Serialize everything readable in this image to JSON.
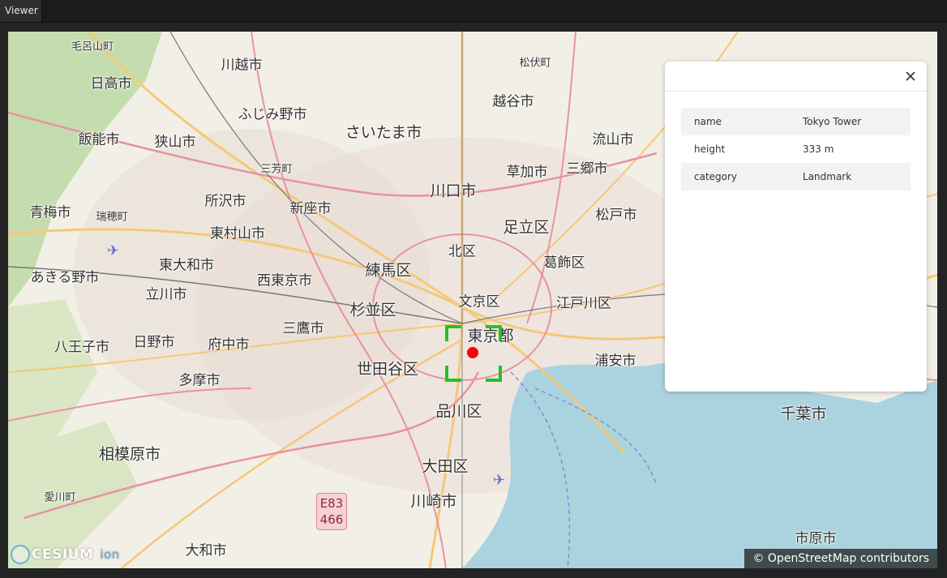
{
  "window": {
    "tab_label": "Viewer"
  },
  "map": {
    "labels": [
      {
        "text": "毛呂山町",
        "size": "small"
      },
      {
        "text": "日高市",
        "size": "med"
      },
      {
        "text": "川越市",
        "size": "med"
      },
      {
        "text": "ふじみ野市",
        "size": "med"
      },
      {
        "text": "越谷市",
        "size": "med"
      },
      {
        "text": "松伏町",
        "size": "small"
      },
      {
        "text": "飯能市",
        "size": "med"
      },
      {
        "text": "狭山市",
        "size": "med"
      },
      {
        "text": "さいたま市",
        "size": "big"
      },
      {
        "text": "流山市",
        "size": "med"
      },
      {
        "text": "三芳町",
        "size": "small"
      },
      {
        "text": "草加市",
        "size": "med"
      },
      {
        "text": "三郷市",
        "size": "med"
      },
      {
        "text": "川口市",
        "size": "big"
      },
      {
        "text": "青梅市",
        "size": "med"
      },
      {
        "text": "瑞穂町",
        "size": "small"
      },
      {
        "text": "所沢市",
        "size": "med"
      },
      {
        "text": "新座市",
        "size": "med"
      },
      {
        "text": "東村山市",
        "size": "med"
      },
      {
        "text": "松戸市",
        "size": "med"
      },
      {
        "text": "足立区",
        "size": "big"
      },
      {
        "text": "北区",
        "size": "med"
      },
      {
        "text": "東大和市",
        "size": "med"
      },
      {
        "text": "練馬区",
        "size": "big"
      },
      {
        "text": "葛飾区",
        "size": "med"
      },
      {
        "text": "あきる野市",
        "size": "med"
      },
      {
        "text": "西東京市",
        "size": "med"
      },
      {
        "text": "立川市",
        "size": "med"
      },
      {
        "text": "文京区",
        "size": "med"
      },
      {
        "text": "江戸川区",
        "size": "med"
      },
      {
        "text": "杉並区",
        "size": "big"
      },
      {
        "text": "三鷹市",
        "size": "med"
      },
      {
        "text": "東京都",
        "size": "big"
      },
      {
        "text": "八王子市",
        "size": "med"
      },
      {
        "text": "日野市",
        "size": "med"
      },
      {
        "text": "府中市",
        "size": "med"
      },
      {
        "text": "浦安市",
        "size": "med"
      },
      {
        "text": "世田谷区",
        "size": "big"
      },
      {
        "text": "多摩市",
        "size": "med"
      },
      {
        "text": "品川区",
        "size": "big"
      },
      {
        "text": "千葉市",
        "size": "big"
      },
      {
        "text": "相模原市",
        "size": "big"
      },
      {
        "text": "大田区",
        "size": "big"
      },
      {
        "text": "愛川町",
        "size": "small"
      },
      {
        "text": "川崎市",
        "size": "big"
      },
      {
        "text": "大和市",
        "size": "med"
      },
      {
        "text": "市原市",
        "size": "med"
      }
    ],
    "shield": {
      "line1": "E83",
      "line2": "466"
    },
    "logo": {
      "brand": "CESIUM",
      "suffix": "ion"
    },
    "attribution": "© OpenStreetMap contributors"
  },
  "infobox": {
    "rows": [
      {
        "key": "name",
        "value": "Tokyo Tower"
      },
      {
        "key": "height",
        "value": "333 m"
      },
      {
        "key": "category",
        "value": "Landmark"
      }
    ]
  }
}
